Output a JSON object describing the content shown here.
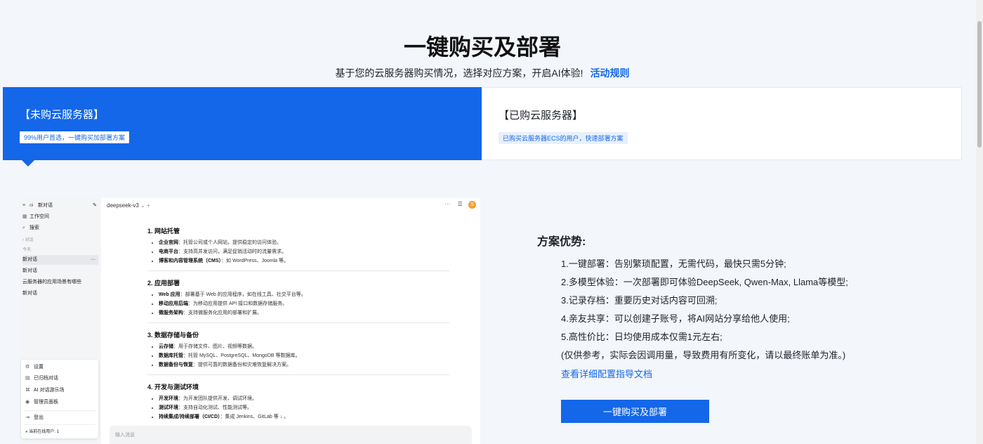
{
  "page": {
    "title": "一键购买及部署",
    "subtitle": "基于您的云服务器购买情况，选择对应方案，开启AI体验!",
    "rules_link": "活动规则"
  },
  "tabs": [
    {
      "title": "【未购云服务器】",
      "badge": "99%用户首选，一键购买加部署方案"
    },
    {
      "title": "【已购云服务器】",
      "badge": "已购买云服务器ECS的用户，快速部署方案"
    }
  ],
  "app": {
    "sidebar": {
      "header": "新对话",
      "workspace": "工作空间",
      "search": "搜索",
      "group_label": "对话",
      "today_label": "今天",
      "chats": [
        "新对话",
        "新对话",
        "云服务器的应用场景有哪些",
        "新对话"
      ],
      "menu": [
        "设置",
        "已归档对话",
        "AI 对话游乐场",
        "管理员面板",
        "登出"
      ],
      "online_users": "当前在线用户: 1"
    },
    "model": "deepseek-v3",
    "avatar_letter": "S",
    "input_placeholder": "输入消息",
    "sections": [
      {
        "heading": "1. 网站托管",
        "items": [
          {
            "label": "企业官网",
            "text": "：托管公司或个人网站，提供稳定的访问体验。"
          },
          {
            "label": "电商平台",
            "text": "：支持高并发访问，满足促销活动时的流量需求。"
          },
          {
            "label": "博客和内容管理系统（CMS）",
            "text": "：如 WordPress、Joomla 等。"
          }
        ]
      },
      {
        "heading": "2. 应用部署",
        "items": [
          {
            "label": "Web 应用",
            "text": "：部署基于 Web 的应用程序，如在线工具、社交平台等。"
          },
          {
            "label": "移动应用后端",
            "text": "：为移动应用提供 API 接口和数据存储服务。"
          },
          {
            "label": "微服务架构",
            "text": "：支持微服务化应用的部署和扩展。"
          }
        ]
      },
      {
        "heading": "3. 数据存储与备份",
        "items": [
          {
            "label": "云存储",
            "text": "：用于存储文件、图片、视频等数据。"
          },
          {
            "label": "数据库托管",
            "text": "：托管 MySQL、PostgreSQL、MongoDB 等数据库。"
          },
          {
            "label": "数据备份与恢复",
            "text": "：提供可靠的数据备份和灾难恢复解决方案。"
          }
        ]
      },
      {
        "heading": "4. 开发与测试环境",
        "items": [
          {
            "label": "开发环境",
            "text": "：为开发团队提供开发、调试环境。"
          },
          {
            "label": "测试环境",
            "text": "：支持自动化测试、性能测试等。"
          },
          {
            "label": "持续集成/持续部署（CI/CD）",
            "text": "：集成 Jenkins、GitLab 等 ↓ 。"
          }
        ]
      }
    ]
  },
  "advantages": {
    "title": "方案优势:",
    "items": [
      "1.一键部署：告别繁琐配置，无需代码，最快只需5分钟;",
      "2.多模型体验：一次部署即可体验DeepSeek, Qwen-Max, Llama等模型;",
      "3.记录存档：重要历史对话内容可回溯;",
      "4.亲友共享：可以创建子账号，将AI网站分享给他人使用;",
      "5.高性价比：日均使用成本仅需1元左右;",
      "(仅供参考，实际会因调用量，导致费用有所变化，请以最终账单为准。)"
    ],
    "doc_link": "查看详细配置指导文档",
    "buy_button": "一键购买及部署"
  },
  "colors": {
    "accent": "#1467e8",
    "background": "#f3f6fa"
  }
}
